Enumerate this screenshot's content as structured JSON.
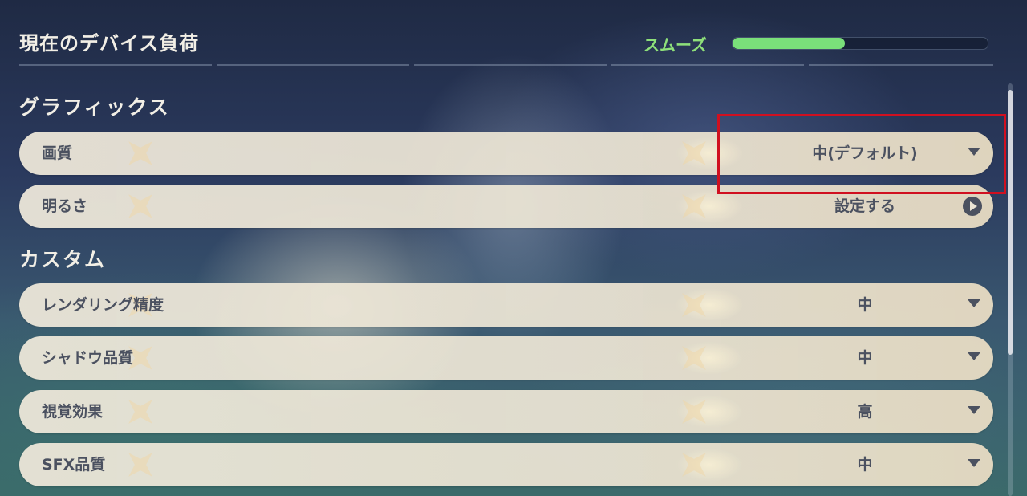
{
  "header": {
    "title": "現在のデバイス負荷",
    "load_status": "スムーズ",
    "load_fill_fraction": 0.44,
    "load_color": "#7ae07a"
  },
  "sections": {
    "graphics": {
      "title": "グラフィックス",
      "quality": {
        "label": "画質",
        "value": "中(デフォルト)"
      },
      "brightness": {
        "label": "明るさ",
        "value": "設定する"
      }
    },
    "custom": {
      "title": "カスタム",
      "render_precision": {
        "label": "レンダリング精度",
        "value": "中"
      },
      "shadow_quality": {
        "label": "シャドウ品質",
        "value": "中"
      },
      "visual_effects": {
        "label": "視覚効果",
        "value": "高"
      },
      "sfx_quality": {
        "label": "SFX品質",
        "value": "中"
      }
    }
  },
  "colors": {
    "highlight": "#d01020",
    "text_dark": "#4b5160",
    "text_light": "#f2efe6"
  },
  "icons": {
    "dropdown": "chevron-down-icon",
    "navigate": "arrow-right-circle-icon"
  }
}
